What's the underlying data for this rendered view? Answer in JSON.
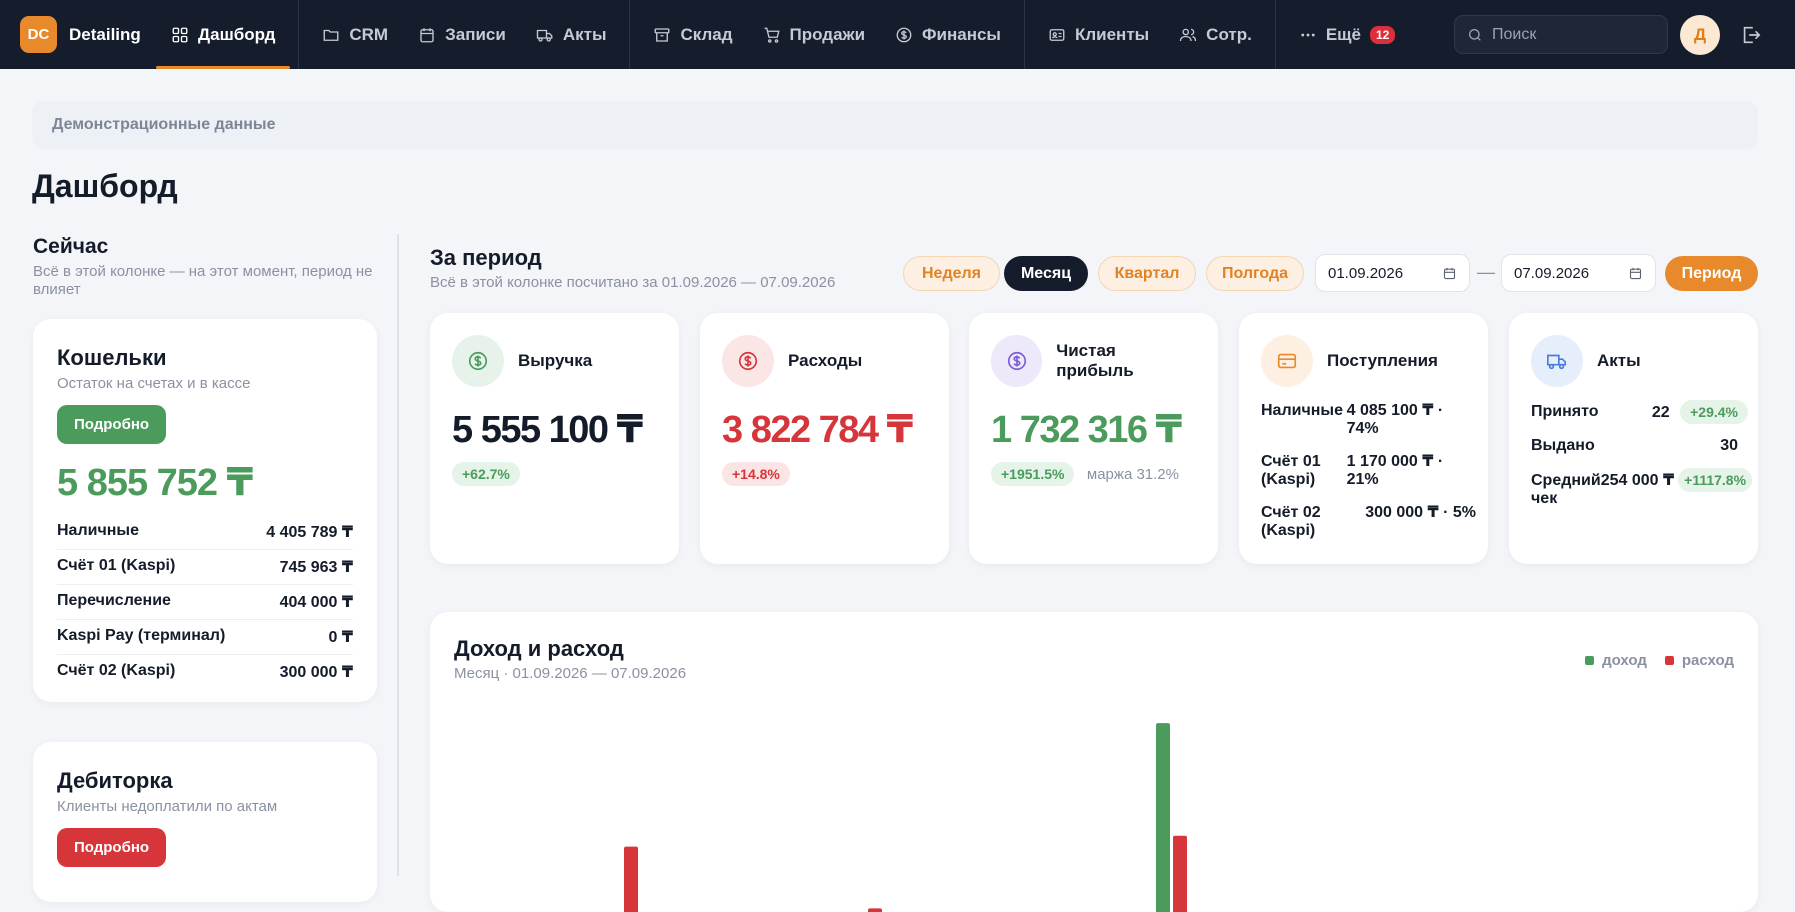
{
  "topbar": {
    "brand_logo": "DC",
    "brand_name": "Detailing",
    "nav": [
      {
        "label": "Дашборд",
        "icon": "grid-icon",
        "active": true
      },
      {
        "label": "CRM",
        "icon": "folder-icon"
      },
      {
        "label": "Записи",
        "icon": "calendar-icon"
      },
      {
        "label": "Акты",
        "icon": "truck-icon"
      },
      {
        "label": "Склад",
        "icon": "box-icon"
      },
      {
        "label": "Продажи",
        "icon": "cart-icon"
      },
      {
        "label": "Финансы",
        "icon": "dollar-icon"
      },
      {
        "label": "Клиенты",
        "icon": "id-card-icon"
      },
      {
        "label": "Сотр.",
        "icon": "users-icon"
      },
      {
        "label": "Ещё",
        "icon": "more-icon",
        "badge": "12"
      }
    ],
    "search_placeholder": "Поиск",
    "avatar_letter": "Д"
  },
  "banner": "Демонстрационные данные",
  "page_title": "Дашборд",
  "now": {
    "title": "Сейчас",
    "subtitle": "Всё в этой колонке — на этот момент, период не влияет"
  },
  "wallets": {
    "title": "Кошельки",
    "subtitle": "Остаток на счетах и в кассе",
    "button": "Подробно",
    "total": "5 855 752 ₸",
    "rows": [
      {
        "label": "Наличные",
        "value": "4 405 789 ₸"
      },
      {
        "label": "Счёт 01 (Kaspi)",
        "value": "745 963 ₸"
      },
      {
        "label": "Перечисление",
        "value": "404 000 ₸"
      },
      {
        "label": "Kaspi Pay (терминал)",
        "value": "0 ₸"
      },
      {
        "label": "Счёт 02 (Kaspi)",
        "value": "300 000 ₸"
      }
    ]
  },
  "debt": {
    "title": "Дебиторка",
    "subtitle": "Клиенты недоплатили по актам",
    "button": "Подробно"
  },
  "period": {
    "title": "За период",
    "subtitle": "Всё в этой колонке посчитано за 01.09.2026 — 07.09.2026",
    "pills": {
      "week": "Неделя",
      "month": "Месяц",
      "quarter": "Квартал",
      "half": "Полгода",
      "custom": "Период"
    },
    "date_from": "01.09.2026",
    "date_to": "07.09.2026",
    "dash": "—"
  },
  "kpi": {
    "revenue": {
      "label": "Выручка",
      "value": "5 555 100 ₸",
      "change": "+62.7%"
    },
    "expenses": {
      "label": "Расходы",
      "value": "3 822 784 ₸",
      "change": "+14.8%"
    },
    "profit": {
      "label": "Чистая прибыль",
      "value": "1 732 316 ₸",
      "change": "+1951.5%",
      "margin": "маржа 31.2%"
    },
    "income": {
      "label": "Поступления",
      "rows": [
        {
          "label": "Наличные",
          "value": "4 085 100 ₸ · 74%"
        },
        {
          "label": "Счёт 01 (Kaspi)",
          "value": "1 170 000 ₸ · 21%"
        },
        {
          "label": "Счёт 02 (Kaspi)",
          "value": "300 000 ₸ · 5%"
        }
      ]
    },
    "acts": {
      "label": "Акты",
      "accepted_label": "Принято",
      "accepted_value": "22",
      "accepted_change": "+29.4%",
      "issued_label": "Выдано",
      "issued_value": "30",
      "avg_label": "Средний чек",
      "avg_value": "254 000 ₸",
      "avg_change": "+1117.8%"
    }
  },
  "colors": {
    "accent": "#e88a2c",
    "green": "#4b9b5c",
    "red": "#d6353a",
    "dark": "#151c2c",
    "purple": "#7b5cd6",
    "blue": "#4a7be0"
  },
  "chart_data": {
    "type": "bar",
    "title": "Доход и расход",
    "subtitle": "Месяц · 01.09.2026 — 07.09.2026",
    "series": [
      {
        "name": "доход",
        "color": "#4b9b5c",
        "values": [
          0,
          0,
          0,
          0,
          0,
          0,
          0,
          0,
          0,
          0,
          5.2
        ]
      },
      {
        "name": "расход",
        "color": "#d6353a",
        "values": [
          0,
          1.8,
          0,
          0,
          0,
          0.1,
          0,
          0,
          0,
          0,
          2.1
        ]
      }
    ]
  }
}
